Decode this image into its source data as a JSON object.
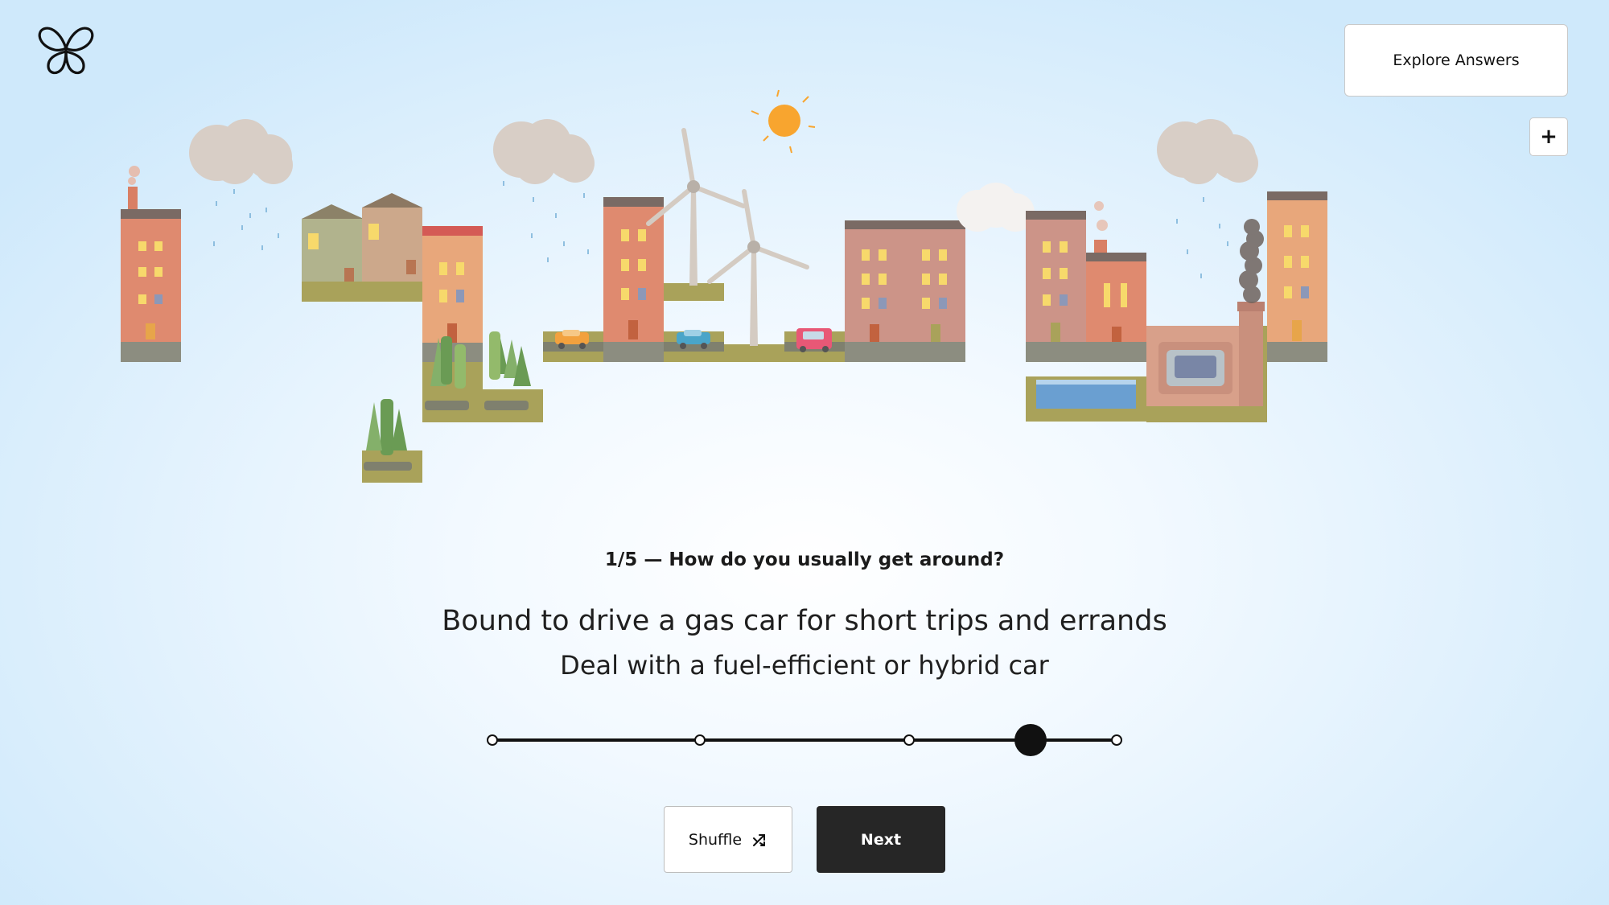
{
  "header": {
    "logo_icon": "butterfly-icon",
    "explore_label": "Explore Answers",
    "zoom_label": "+"
  },
  "quiz": {
    "question": "1/5 — How do you usually get around?",
    "statement_primary": "Bound to drive a gas car for short trips and errands",
    "statement_secondary": "Deal with a fuel-efficient or hybrid car",
    "slider": {
      "stops": 5,
      "selected": 4
    }
  },
  "actions": {
    "shuffle_label": "Shuffle",
    "shuffle_icon": "shuffle-icon",
    "next_label": "Next"
  },
  "scene": {
    "description_icons": [
      "cloud-icon",
      "sun-icon",
      "wind-turbine-icon",
      "car-icon",
      "factory-icon",
      "tree-icon"
    ]
  }
}
